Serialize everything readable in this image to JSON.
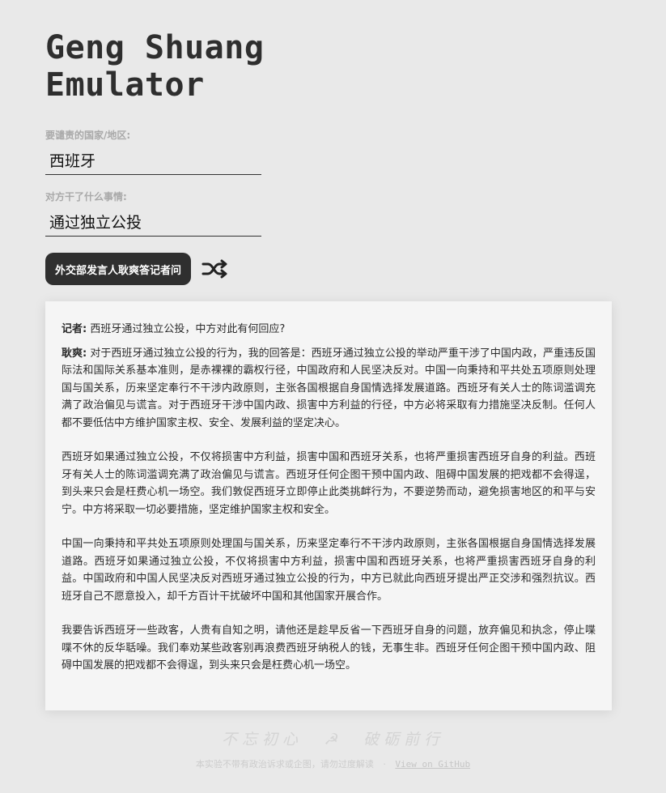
{
  "app": {
    "title_line1": "Geng Shuang",
    "title_line2": "Emulator"
  },
  "form": {
    "country_label": "要谴责的国家/地区:",
    "country_value": "西班牙",
    "action_label": "对方干了什么事情:",
    "action_value": "通过独立公投",
    "submit_label": "外交部发言人耿爽答记者问",
    "shuffle_icon": "shuffle-icon"
  },
  "result": {
    "reporter_label": "记者:",
    "question": "西班牙通过独立公投，中方对此有何回应?",
    "speaker_label": "耿爽:",
    "paragraphs": [
      "对于西班牙通过独立公投的行为，我的回答是：西班牙通过独立公投的举动严重干涉了中国内政，严重违反国际法和国际关系基本准则，是赤裸裸的霸权行径，中国政府和人民坚决反对。中国一向秉持和平共处五项原则处理国与国关系，历来坚定奉行不干涉内政原则，主张各国根据自身国情选择发展道路。西班牙有关人士的陈词滥调充满了政治偏见与谎言。对于西班牙干涉中国内政、损害中方利益的行径，中方必将采取有力措施坚决反制。任何人都不要低估中方维护国家主权、安全、发展利益的坚定决心。",
      "西班牙如果通过独立公投，不仅将损害中方利益，损害中国和西班牙关系，也将严重损害西班牙自身的利益。西班牙有关人士的陈词滥调充满了政治偏见与谎言。西班牙任何企图干预中国内政、阻碍中国发展的把戏都不会得逞，到头来只会是枉费心机一场空。我们敦促西班牙立即停止此类挑衅行为，不要逆势而动，避免损害地区的和平与安宁。中方将采取一切必要措施，坚定维护国家主权和安全。",
      "中国一向秉持和平共处五项原则处理国与国关系，历来坚定奉行不干涉内政原则，主张各国根据自身国情选择发展道路。西班牙如果通过独立公投，不仅将损害中方利益，损害中国和西班牙关系，也将严重损害西班牙自身的利益。中国政府和中国人民坚决反对西班牙通过独立公投的行为，中方已就此向西班牙提出严正交涉和强烈抗议。西班牙自己不愿意投入，却千方百计干扰破坏中国和其他国家开展合作。",
      "我要告诉西班牙一些政客，人贵有自知之明，请他还是趁早反省一下西班牙自身的问题，放弃偏见和执念，停止喋喋不休的反华聒噪。我们奉劝某些政客别再浪费西班牙纳税人的钱，无事生非。西班牙任何企图干预中国内政、阻碍中国发展的把戏都不会得逞，到头来只会是枉费心机一场空。"
    ]
  },
  "footer": {
    "motto_left": "不忘初心",
    "motto_symbol": "☭",
    "motto_right": "破砺前行",
    "disclaimer": "本实验不带有政治诉求或企图，请勿过度解读",
    "separator": "·",
    "github_link": "View on GitHub"
  }
}
